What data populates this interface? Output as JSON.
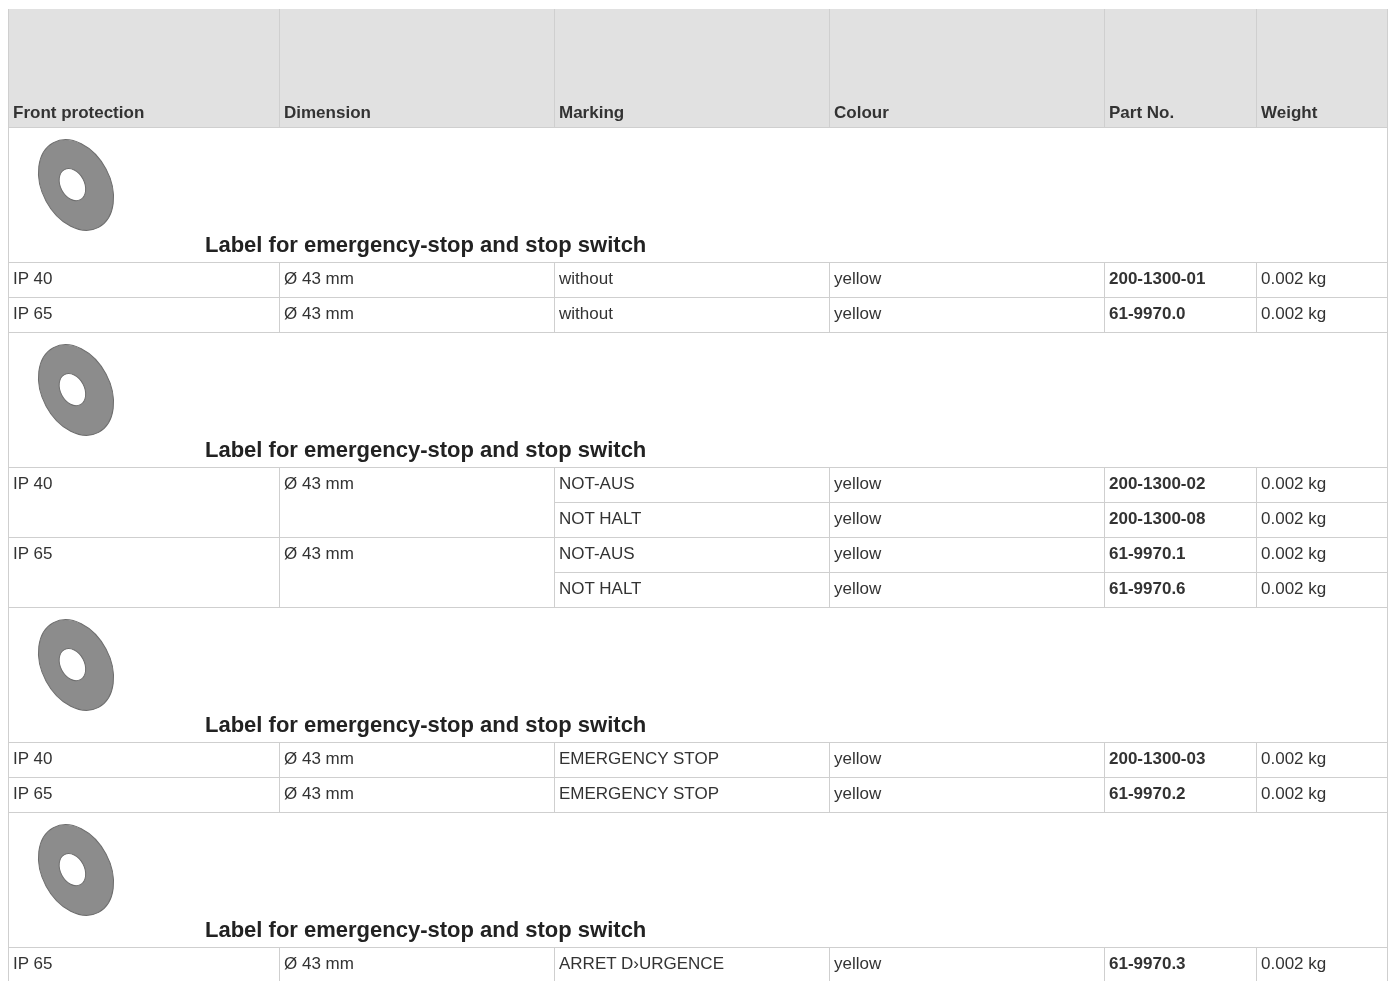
{
  "table": {
    "columns": [
      "Front protection",
      "Dimension",
      "Marking",
      "Colour",
      "Part No.",
      "Weight"
    ],
    "sections": [
      {
        "title": "Label for emergency-stop and stop switch",
        "groups": [
          {
            "front_protection": "IP 40",
            "dimension": "Ø 43 mm",
            "variants": [
              {
                "marking": "without",
                "colour": "yellow",
                "part_no": "200-1300-01",
                "weight": "0.002 kg"
              }
            ]
          },
          {
            "front_protection": "IP 65",
            "dimension": "Ø 43 mm",
            "variants": [
              {
                "marking": "without",
                "colour": "yellow",
                "part_no": "61-9970.0",
                "weight": "0.002 kg"
              }
            ]
          }
        ]
      },
      {
        "title": "Label for emergency-stop and stop switch",
        "groups": [
          {
            "front_protection": "IP 40",
            "dimension": "Ø 43 mm",
            "variants": [
              {
                "marking": "NOT-AUS",
                "colour": "yellow",
                "part_no": "200-1300-02",
                "weight": "0.002 kg"
              },
              {
                "marking": "NOT HALT",
                "colour": "yellow",
                "part_no": "200-1300-08",
                "weight": "0.002 kg"
              }
            ]
          },
          {
            "front_protection": "IP 65",
            "dimension": "Ø 43 mm",
            "variants": [
              {
                "marking": "NOT-AUS",
                "colour": "yellow",
                "part_no": "61-9970.1",
                "weight": "0.002 kg"
              },
              {
                "marking": "NOT HALT",
                "colour": "yellow",
                "part_no": "61-9970.6",
                "weight": "0.002 kg"
              }
            ]
          }
        ]
      },
      {
        "title": "Label for emergency-stop and stop switch",
        "groups": [
          {
            "front_protection": "IP 40",
            "dimension": "Ø 43 mm",
            "variants": [
              {
                "marking": "EMERGENCY STOP",
                "colour": "yellow",
                "part_no": "200-1300-03",
                "weight": "0.002 kg"
              }
            ]
          },
          {
            "front_protection": "IP 65",
            "dimension": "Ø 43 mm",
            "variants": [
              {
                "marking": "EMERGENCY STOP",
                "colour": "yellow",
                "part_no": "61-9970.2",
                "weight": "0.002 kg"
              }
            ]
          }
        ]
      },
      {
        "title": "Label for emergency-stop and stop switch",
        "groups": [
          {
            "front_protection": "IP 65",
            "dimension": "Ø 43 mm",
            "variants": [
              {
                "marking": "ARRET D›URGENCE",
                "colour": "yellow",
                "part_no": "61-9970.3",
                "weight": "0.002 kg"
              }
            ]
          }
        ]
      }
    ]
  }
}
